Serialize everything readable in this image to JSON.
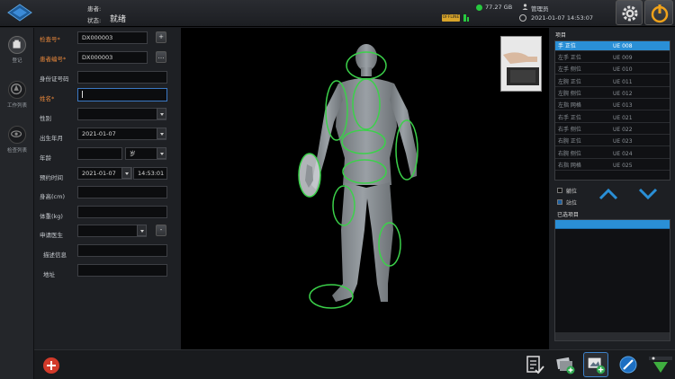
{
  "topbar": {
    "patient_label": "患者:",
    "status_label": "状态:",
    "status_value": "就绪",
    "offline_badge": "OFFLINE",
    "disk": "77.27 GB",
    "user": "管理员",
    "datetime": "2021-01-07 14:53:07"
  },
  "nav": [
    {
      "label": "登记",
      "icon": "register-icon"
    },
    {
      "label": "工作列表",
      "icon": "worklist-icon"
    },
    {
      "label": "检查列表",
      "icon": "eye-icon"
    }
  ],
  "form": {
    "exam_no_label": "检查号*",
    "exam_no_value": "DX000003",
    "patient_no_label": "患者编号*",
    "patient_no_value": "DX000003",
    "id_label": "身份证号码",
    "name_label": "姓名*",
    "gender_label": "性别",
    "birth_label": "出生年月",
    "birth_value": "2021-01-07",
    "age_label": "年龄",
    "age_unit": "岁",
    "appt_label": "预约时间",
    "appt_date": "2021-01-07",
    "appt_time": "14:53:01",
    "height_label": "身高(cm)",
    "weight_label": "体重(kg)",
    "doctor_label": "申请医生",
    "desc_label": "描述信息",
    "address_label": "地址"
  },
  "items": {
    "title": "项目",
    "rows": [
      {
        "name": "手 正位",
        "code": "UE 008"
      },
      {
        "name": "左手 正位",
        "code": "UE 009"
      },
      {
        "name": "左手 侧位",
        "code": "UE 010"
      },
      {
        "name": "左腕 正位",
        "code": "UE 011"
      },
      {
        "name": "左腕 侧位",
        "code": "UE 012"
      },
      {
        "name": "左指 网格",
        "code": "UE 013"
      },
      {
        "name": "右手 正位",
        "code": "UE 021"
      },
      {
        "name": "右手 侧位",
        "code": "UE 022"
      },
      {
        "name": "右腕 正位",
        "code": "UE 023"
      },
      {
        "name": "右腕 侧位",
        "code": "UE 024"
      },
      {
        "name": "右指 网格",
        "code": "UE 025"
      }
    ],
    "option_back": "躺位",
    "option_stand": "站位",
    "selected_title": "已选项目"
  },
  "colors": {
    "accent": "#2a8fd6",
    "highlight_ellipse": "#3bd14a",
    "required_label": "#e8873b"
  }
}
